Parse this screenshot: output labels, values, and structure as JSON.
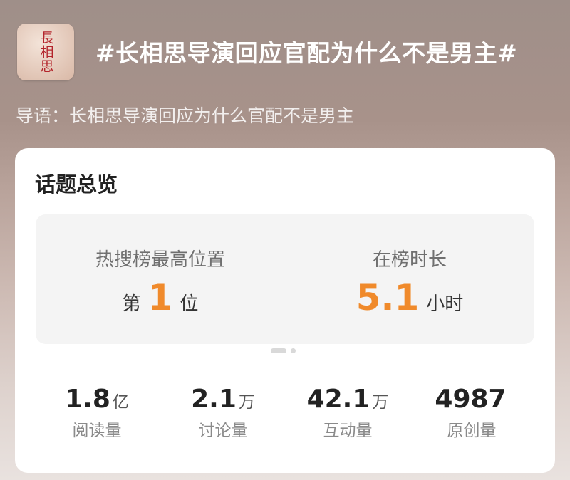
{
  "topic": {
    "title": "#长相思导演回应官配为什么不是男主#",
    "cover_logo_text": "長相思",
    "intro": "导语：长相思导演回应为什么官配不是男主"
  },
  "overview": {
    "title": "话题总览",
    "highlights": [
      {
        "label": "热搜榜最高位置",
        "prefix": "第",
        "value": "1",
        "suffix": "位"
      },
      {
        "label": "在榜时长",
        "prefix": "",
        "value": "5.1",
        "suffix": "小时"
      }
    ],
    "pager": {
      "current": 1,
      "total": 2
    },
    "stats": [
      {
        "value": "1.8",
        "unit": "亿",
        "label": "阅读量"
      },
      {
        "value": "2.1",
        "unit": "万",
        "label": "讨论量"
      },
      {
        "value": "42.1",
        "unit": "万",
        "label": "互动量"
      },
      {
        "value": "4987",
        "unit": "",
        "label": "原创量"
      }
    ]
  },
  "colors": {
    "accent": "#f08a2b",
    "card_bg": "#ffffff",
    "highlight_bg": "#f4f4f4",
    "cover_text": "#b3242b"
  }
}
